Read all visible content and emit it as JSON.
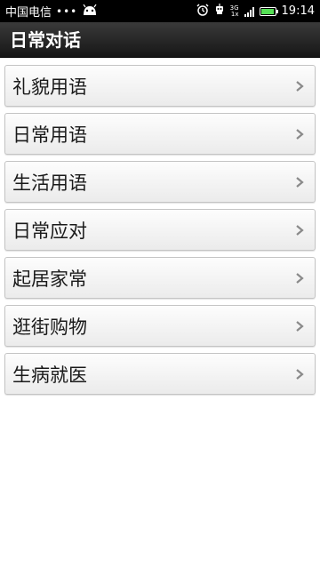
{
  "status_bar": {
    "carrier": "中国电信",
    "dots": "•••",
    "network_top": "3G",
    "network_bottom": "1x",
    "time": "19:14",
    "battery_level": 0.9,
    "icons": [
      "android-icon",
      "alarm-icon",
      "robot-icon",
      "signal-icon",
      "battery-icon"
    ]
  },
  "header": {
    "title": "日常对话"
  },
  "menu": {
    "items": [
      {
        "label": "礼貌用语"
      },
      {
        "label": "日常用语"
      },
      {
        "label": "生活用语"
      },
      {
        "label": "日常应对"
      },
      {
        "label": "起居家常"
      },
      {
        "label": "逛街购物"
      },
      {
        "label": "生病就医"
      }
    ]
  },
  "colors": {
    "titlebar": "#1e1e1e",
    "item_bg": "#f3f3f3",
    "battery": "#55e055"
  }
}
